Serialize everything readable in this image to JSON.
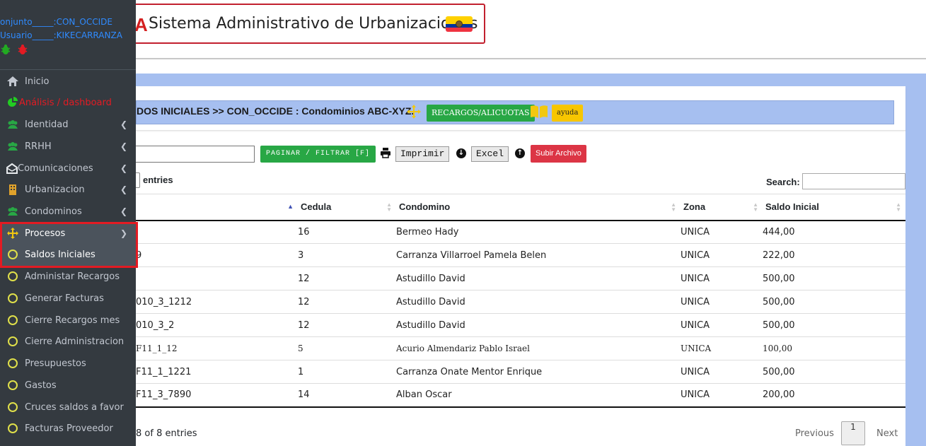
{
  "header": {
    "logo_letter": "A",
    "title": "Sistema Administrativo de Urbanizaciones",
    "flag_icon": "ecuador-flag-icon"
  },
  "sidebar": {
    "user_line1": "onjunto_____:CON_OCCIDE",
    "user_line2": "Usuario_____:KIKECARRANZA",
    "status_icons": [
      "bug-green-icon",
      "bug-red-icon"
    ],
    "items": [
      {
        "label": "Inicio",
        "icon": "home-icon"
      },
      {
        "label": "Análisis / dashboard",
        "icon": "pie-chart-icon"
      },
      {
        "label": "Identidad",
        "icon": "users-icon"
      },
      {
        "label": "RRHH",
        "icon": "users-icon"
      },
      {
        "label": "Comunicaciones",
        "icon": "envelope-open-icon"
      },
      {
        "label": "Urbanizacion",
        "icon": "building-icon"
      },
      {
        "label": "Condominos",
        "icon": "users-icon"
      },
      {
        "label": "Procesos",
        "icon": "arrows-icon"
      },
      {
        "label": "Saldos Iniciales",
        "icon": "circle-icon"
      },
      {
        "label": "Administar Recargos",
        "icon": "circle-icon"
      },
      {
        "label": "Generar Facturas",
        "icon": "circle-icon"
      },
      {
        "label": "Cierre Recargos mes",
        "icon": "circle-icon"
      },
      {
        "label": "Cierre Administracion",
        "icon": "circle-icon"
      },
      {
        "label": "Presupuestos",
        "icon": "circle-icon"
      },
      {
        "label": "Gastos",
        "icon": "circle-icon"
      },
      {
        "label": "Cruces saldos a favor",
        "icon": "circle-icon"
      },
      {
        "label": "Facturas Proveedor",
        "icon": "circle-icon"
      }
    ]
  },
  "breadcrumb": {
    "text": "DOS INICIALES >> CON_OCCIDE : Condominios ABC-XYZ.",
    "recargos_label": "RECARGOS/ALICUOTAS",
    "ayuda_label": "ayuda"
  },
  "toolbar": {
    "paginar_label": "PAGINAR / FILTRAR [F]",
    "imprimir_label": "Imprimir",
    "excel_label": "Excel",
    "subir_label": "Subir Archivo"
  },
  "table_controls": {
    "entries_label": "entries",
    "search_label": "Search:"
  },
  "table": {
    "columns": [
      "",
      "Cedula",
      "Condomino",
      "Zona",
      "Saldo Inicial"
    ],
    "rows": [
      [
        "",
        "16",
        "Bermeo Hady",
        "UNICA",
        "444,00"
      ],
      [
        "9",
        "3",
        "Carranza Villarroel Pamela Belen",
        "UNICA",
        "222,00"
      ],
      [
        "",
        "12",
        "Astudillo David",
        "UNICA",
        "500,00"
      ],
      [
        "010_3_1212",
        "12",
        "Astudillo David",
        "UNICA",
        "500,00"
      ],
      [
        "010_3_2",
        "12",
        "Astudillo David",
        "UNICA",
        "500,00"
      ],
      [
        "F11_1_12",
        "5",
        "Acurio Almendariz Pablo Israel",
        "UNICA",
        "100,00"
      ],
      [
        "F11_1_1221",
        "1",
        "Carranza Onate Mentor Enrique",
        "UNICA",
        "500,00"
      ],
      [
        "F11_3_7890",
        "14",
        "Alban Oscar",
        "UNICA",
        "200,00"
      ]
    ]
  },
  "footer": {
    "info": "8 of 8 entries",
    "previous_label": "Previous",
    "page": "1",
    "next_label": "Next"
  }
}
